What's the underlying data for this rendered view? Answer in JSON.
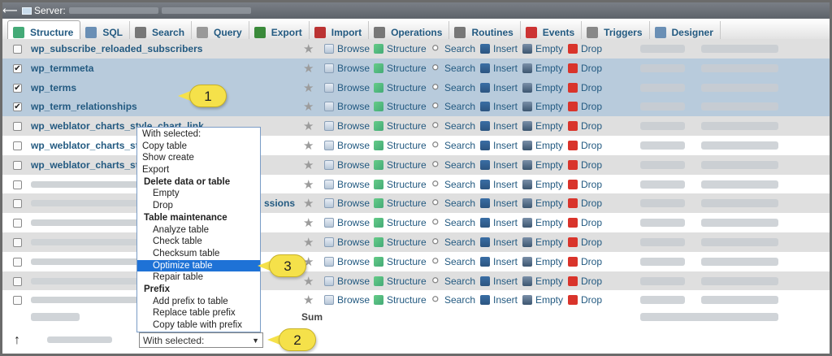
{
  "topbar": {
    "label": "Server:"
  },
  "tabs": [
    {
      "label": "Structure",
      "icon": "structure-icon",
      "color": "#4a7"
    },
    {
      "label": "SQL",
      "icon": "sql-icon",
      "color": "#6a8fb5"
    },
    {
      "label": "Search",
      "icon": "search-icon",
      "color": "#777"
    },
    {
      "label": "Query",
      "icon": "query-icon",
      "color": "#999"
    },
    {
      "label": "Export",
      "icon": "export-icon",
      "color": "#3a8a3a"
    },
    {
      "label": "Import",
      "icon": "import-icon",
      "color": "#b33"
    },
    {
      "label": "Operations",
      "icon": "wrench-icon",
      "color": "#777"
    },
    {
      "label": "Routines",
      "icon": "routines-icon",
      "color": "#777"
    },
    {
      "label": "Events",
      "icon": "clock-icon",
      "color": "#c33"
    },
    {
      "label": "Triggers",
      "icon": "triggers-icon",
      "color": "#888"
    },
    {
      "label": "Designer",
      "icon": "designer-icon",
      "color": "#6a8fb5"
    }
  ],
  "actions": {
    "browse": "Browse",
    "structure": "Structure",
    "search": "Search",
    "insert": "Insert",
    "empty": "Empty",
    "drop": "Drop"
  },
  "rows": [
    {
      "name": "wp_subscribe_reloaded_subscribers",
      "checked": false,
      "state": "even"
    },
    {
      "name": "wp_termmeta",
      "checked": true,
      "state": "sel"
    },
    {
      "name": "wp_terms",
      "checked": true,
      "state": "sel"
    },
    {
      "name": "wp_term_relationships",
      "checked": true,
      "state": "sel"
    },
    {
      "name": "wp_weblator_charts_style_chart_link",
      "checked": false,
      "state": "even"
    },
    {
      "name": "wp_weblator_charts_st",
      "checked": false,
      "state": "odd"
    },
    {
      "name": "wp_weblator_charts_st",
      "checked": false,
      "state": "even"
    },
    {
      "name": "",
      "checked": false,
      "state": "odd"
    },
    {
      "name": "ssions",
      "checked": false,
      "state": "even"
    },
    {
      "name": "",
      "checked": false,
      "state": "odd"
    },
    {
      "name": "",
      "checked": false,
      "state": "even"
    },
    {
      "name": "",
      "checked": false,
      "state": "odd"
    },
    {
      "name": "",
      "checked": false,
      "state": "even"
    },
    {
      "name": "",
      "checked": false,
      "state": "odd"
    }
  ],
  "sum_label": "Sum",
  "select": {
    "value": "With selected:"
  },
  "dropdown": {
    "items": [
      {
        "label": "With selected:",
        "kind": "item"
      },
      {
        "label": "Copy table",
        "kind": "item"
      },
      {
        "label": "Show create",
        "kind": "item"
      },
      {
        "label": "Export",
        "kind": "item"
      },
      {
        "label": "Delete data or table",
        "kind": "grp"
      },
      {
        "label": "Empty",
        "kind": "sub"
      },
      {
        "label": "Drop",
        "kind": "sub"
      },
      {
        "label": "Table maintenance",
        "kind": "grp"
      },
      {
        "label": "Analyze table",
        "kind": "sub"
      },
      {
        "label": "Check table",
        "kind": "sub"
      },
      {
        "label": "Checksum table",
        "kind": "sub"
      },
      {
        "label": "Optimize table",
        "kind": "sub",
        "highlight": true
      },
      {
        "label": "Repair table",
        "kind": "sub"
      },
      {
        "label": "Prefix",
        "kind": "grp"
      },
      {
        "label": "Add prefix to table",
        "kind": "sub"
      },
      {
        "label": "Replace table prefix",
        "kind": "sub"
      },
      {
        "label": "Copy table with prefix",
        "kind": "sub"
      }
    ]
  },
  "callouts": [
    {
      "label": "1"
    },
    {
      "label": "2"
    },
    {
      "label": "3"
    }
  ],
  "colors": {
    "link": "#235a81",
    "selected_row": "#b8cbdc",
    "highlight": "#1e72d6",
    "callout": "#f5e14a"
  }
}
